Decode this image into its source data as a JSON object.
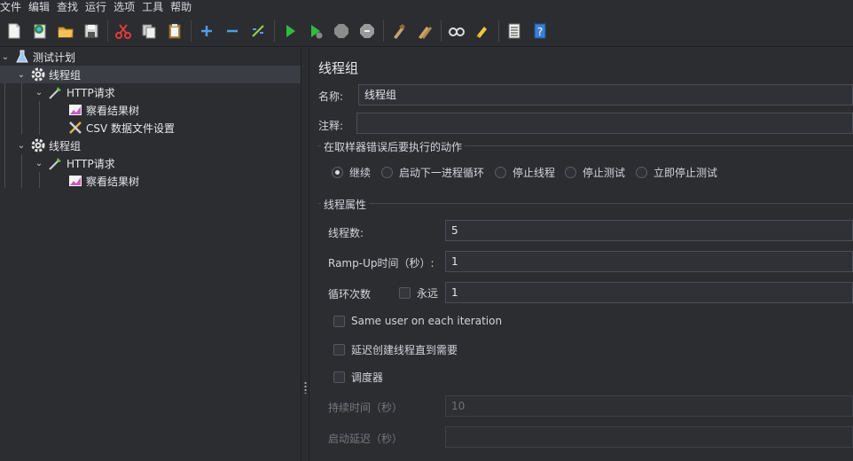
{
  "menu": [
    "文件",
    "编辑",
    "查找",
    "运行",
    "选项",
    "工具",
    "帮助"
  ],
  "toolbar": {
    "icons": [
      "new-icon",
      "templates-icon",
      "open-icon",
      "save-icon",
      "cut-icon",
      "copy-icon",
      "paste-icon",
      "expand-icon",
      "collapse-icon",
      "toggle-icon",
      "start-icon",
      "start-no-pause-icon",
      "stop-icon",
      "shutdown-icon",
      "clear-icon",
      "clear-all-icon",
      "search-icon",
      "reset-search-icon",
      "function-helper-icon",
      "help-icon"
    ]
  },
  "tree": {
    "items": [
      {
        "label": "测试计划",
        "icon": "test-plan-icon"
      },
      {
        "label": "线程组",
        "icon": "thread-group-icon"
      },
      {
        "label": "HTTP请求",
        "icon": "http-sampler-icon"
      },
      {
        "label": "察看结果树",
        "icon": "result-tree-icon"
      },
      {
        "label": "CSV 数据文件设置",
        "icon": "csv-config-icon"
      },
      {
        "label": "线程组",
        "icon": "thread-group-icon"
      },
      {
        "label": "HTTP请求",
        "icon": "http-sampler-icon"
      },
      {
        "label": "察看结果树",
        "icon": "result-tree-icon"
      }
    ]
  },
  "panel": {
    "title": "线程组",
    "name_label": "名称:",
    "name_value": "线程组",
    "comment_label": "注释:",
    "comment_value": "",
    "error_group_title": "在取样器错误后要执行的动作",
    "error_actions": [
      "继续",
      "启动下一进程循环",
      "停止线程",
      "停止测试",
      "立即停止测试"
    ],
    "selected_action": 0,
    "props_title": "线程属性",
    "threads_label": "线程数:",
    "threads_value": "5",
    "rampup_label": "Ramp-Up时间（秒）:",
    "rampup_value": "1",
    "loop_label": "循环次数",
    "forever_label": "永远",
    "loop_value": "1",
    "same_user_label": "Same user on each iteration",
    "delay_create_label": "延迟创建线程直到需要",
    "scheduler_label": "调度器",
    "duration_label": "持续时间（秒）",
    "duration_value": "10",
    "startup_delay_label": "启动延迟（秒）",
    "startup_delay_value": ""
  }
}
